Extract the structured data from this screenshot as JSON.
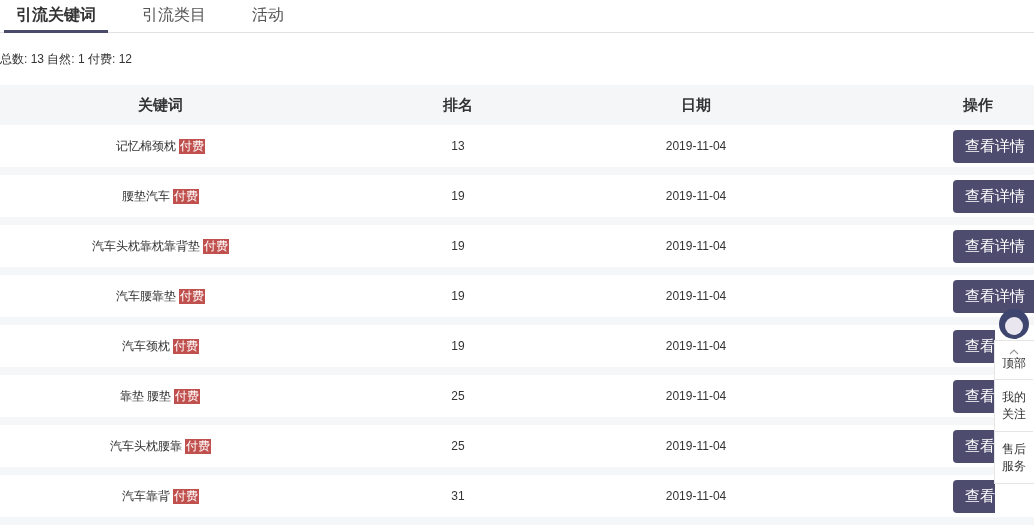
{
  "tabs": [
    {
      "label": "引流关键词",
      "selected": true
    },
    {
      "label": "引流类目",
      "selected": false
    },
    {
      "label": "活动",
      "selected": false
    }
  ],
  "summary": "总数: 13 自然: 1 付费: 12",
  "table": {
    "columns": [
      "关键词",
      "排名",
      "日期",
      "操作"
    ],
    "rows": [
      {
        "keyword": "记忆棉颈枕",
        "tag": "付费",
        "rank": "13",
        "date": "2019-11-04",
        "action": "查看详情"
      },
      {
        "keyword": "腰垫汽车",
        "tag": "付费",
        "rank": "19",
        "date": "2019-11-04",
        "action": "查看详情"
      },
      {
        "keyword": "汽车头枕靠枕靠背垫",
        "tag": "付费",
        "rank": "19",
        "date": "2019-11-04",
        "action": "查看详情"
      },
      {
        "keyword": "汽车腰靠垫",
        "tag": "付费",
        "rank": "19",
        "date": "2019-11-04",
        "action": "查看详情"
      },
      {
        "keyword": "汽车颈枕",
        "tag": "付费",
        "rank": "19",
        "date": "2019-11-04",
        "action": "查看",
        "kind": "partial"
      },
      {
        "keyword": "靠垫 腰垫",
        "tag": "付费",
        "rank": "25",
        "date": "2019-11-04",
        "action": "查看",
        "kind": "partial"
      },
      {
        "keyword": "汽车头枕腰靠",
        "tag": "付费",
        "rank": "25",
        "date": "2019-11-04",
        "action": "查看",
        "kind": "partial"
      },
      {
        "keyword": "汽车靠背",
        "tag": "付费",
        "rank": "31",
        "date": "2019-11-04",
        "action": "查看",
        "kind": "partial"
      }
    ]
  },
  "float_panel": {
    "items": [
      {
        "kind": "top",
        "label": "顶部"
      },
      {
        "kind": "link",
        "label": "我的关注"
      },
      {
        "kind": "link",
        "label": "售后服务"
      }
    ]
  }
}
